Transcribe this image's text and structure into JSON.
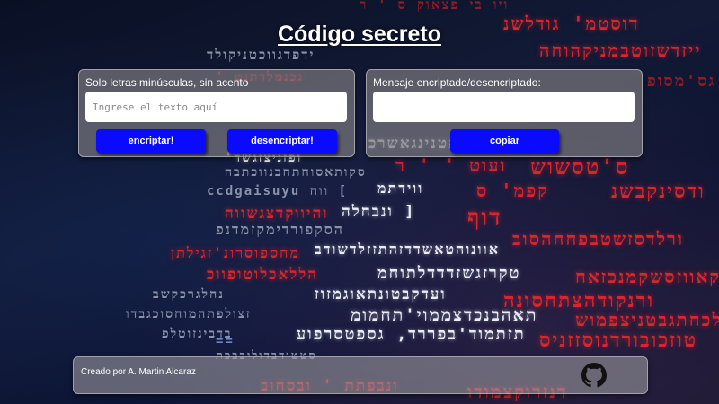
{
  "page": {
    "title": "Código secreto"
  },
  "input_panel": {
    "label": "Solo letras minúsculas, sin acento",
    "placeholder": "Ingrese el texto aquí",
    "encrypt_label": "encriptar!",
    "decrypt_label": "desencriptar!"
  },
  "output_panel": {
    "label": "Mensaje encriptado/desencriptado:",
    "value": "",
    "copy_label": "copiar"
  },
  "footer": {
    "credit": "Creado por A. Martin Alcaraz",
    "github_icon": "github-icon"
  },
  "colors": {
    "button": "#0a0aff",
    "title": "#ffffff",
    "code_red": "#d7262e"
  }
}
